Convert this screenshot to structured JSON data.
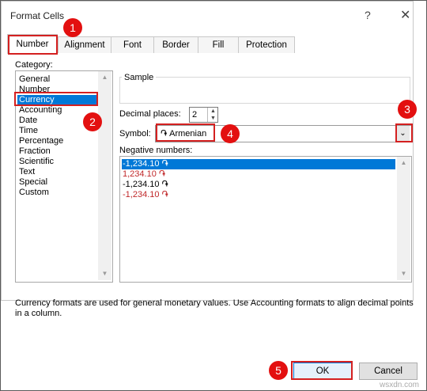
{
  "window": {
    "title": "Format Cells",
    "help_label": "?",
    "close_label": "✕"
  },
  "tabs": [
    {
      "label": "Number"
    },
    {
      "label": "Alignment"
    },
    {
      "label": "Font"
    },
    {
      "label": "Border"
    },
    {
      "label": "Fill"
    },
    {
      "label": "Protection"
    }
  ],
  "category": {
    "label": "Category:",
    "items": [
      "General",
      "Number",
      "Currency",
      "Accounting",
      "Date",
      "Time",
      "Percentage",
      "Fraction",
      "Scientific",
      "Text",
      "Special",
      "Custom"
    ],
    "selected": "Currency"
  },
  "sample": {
    "label": "Sample",
    "value": ""
  },
  "decimal_places": {
    "label": "Decimal places:",
    "value": "2"
  },
  "symbol": {
    "label": "Symbol:",
    "value": "֏ Armenian"
  },
  "negative_numbers": {
    "label": "Negative numbers:",
    "items": [
      {
        "text": "-1,234.10 ֏",
        "red": false,
        "selected": true
      },
      {
        "text": "1,234.10 ֏",
        "red": true,
        "selected": false
      },
      {
        "text": "-1,234.10 ֏",
        "red": false,
        "selected": false
      },
      {
        "text": "-1,234.10 ֏",
        "red": true,
        "selected": false
      }
    ]
  },
  "description": "Currency formats are used for general monetary values.  Use Accounting formats to align decimal points in a column.",
  "buttons": {
    "ok": "OK",
    "cancel": "Cancel"
  },
  "badges": [
    "1",
    "2",
    "3",
    "4",
    "5"
  ],
  "watermark": "wsxdn.com",
  "colors": {
    "selection": "#0078d7",
    "highlight_box": "#d42020",
    "badge": "#e31010",
    "negative_red": "#c0282a"
  }
}
